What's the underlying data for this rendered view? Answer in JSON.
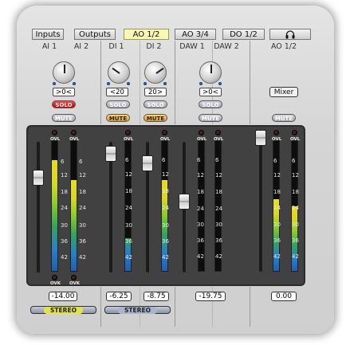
{
  "tabs": [
    {
      "label": "Inputs",
      "active": false
    },
    {
      "label": "Outputs",
      "active": false
    },
    {
      "label": "AO 1/2",
      "active": true
    },
    {
      "label": "AO 3/4",
      "active": false
    },
    {
      "label": "DO 1/2",
      "active": false
    },
    {
      "label": "☖",
      "icon": "headphones-icon",
      "active": false
    }
  ],
  "channels": {
    "ai1": {
      "name": "AI 1",
      "gain": ">0<",
      "solo": "SOLO",
      "mute": "MUTE",
      "solo_on": true,
      "mute_on": false,
      "ovl_top": "OVL",
      "ovl_bottom": "OVK",
      "fader_db": -14.0,
      "meter_level": 0.85
    },
    "ai2": {
      "name": "AI 2",
      "ovl_top": "OVL",
      "ovl_bottom": "OVK",
      "meter_level": 0.7
    },
    "di1": {
      "name": "DI 1",
      "gain": "<20",
      "solo": "SOLO",
      "mute": "MUTE",
      "solo_on": false,
      "mute_on": true,
      "ovl_top": "OVL",
      "fader_db": -6.25,
      "meter_level": 0.25
    },
    "di2": {
      "name": "DI 2",
      "gain": "20>",
      "solo": "SOLO",
      "mute": "MUTE",
      "solo_on": false,
      "mute_on": true,
      "ovl_top": "OVL",
      "fader_db": -8.75,
      "meter_level": 0.7
    },
    "daw1": {
      "name": "DAW 1",
      "gain": ">0<",
      "solo": "SOLO",
      "mute": "MUTE",
      "solo_on": false,
      "mute_on": false,
      "ovl_top": "OVL",
      "fader_db": -19.75,
      "meter_level": 0.0
    },
    "daw2": {
      "name": "DAW 2",
      "ovl_top": "OVL",
      "meter_level": 0.0
    },
    "ao12": {
      "name": "AO 1/2",
      "mixer_button": "Mixer",
      "mute": "MUTE",
      "mute_on": false,
      "ovl_top": "OVL",
      "fader_db": 0.0,
      "meter_level_l": 0.55,
      "meter_level_r": 0.5
    }
  },
  "scale": [
    "6",
    "12",
    "18",
    "24",
    "30",
    "36",
    "42"
  ],
  "values": {
    "ai": "-14.00",
    "di1": "-6.25",
    "di2": "-8.75",
    "daw": "-19.75",
    "ao": "0.00"
  },
  "stereo_links": [
    {
      "label": "STEREO",
      "on": true
    },
    {
      "label": "STEREO",
      "on": false
    }
  ],
  "colors": {
    "tab_active": "#f8f8b6",
    "solo_active": "#e02020",
    "mute_active": "#f0b840",
    "stereo_active": "#e2e24a",
    "meter_blue": "#2a80c8",
    "meter_green": "#32a45a",
    "meter_yellow": "#dada1e"
  }
}
